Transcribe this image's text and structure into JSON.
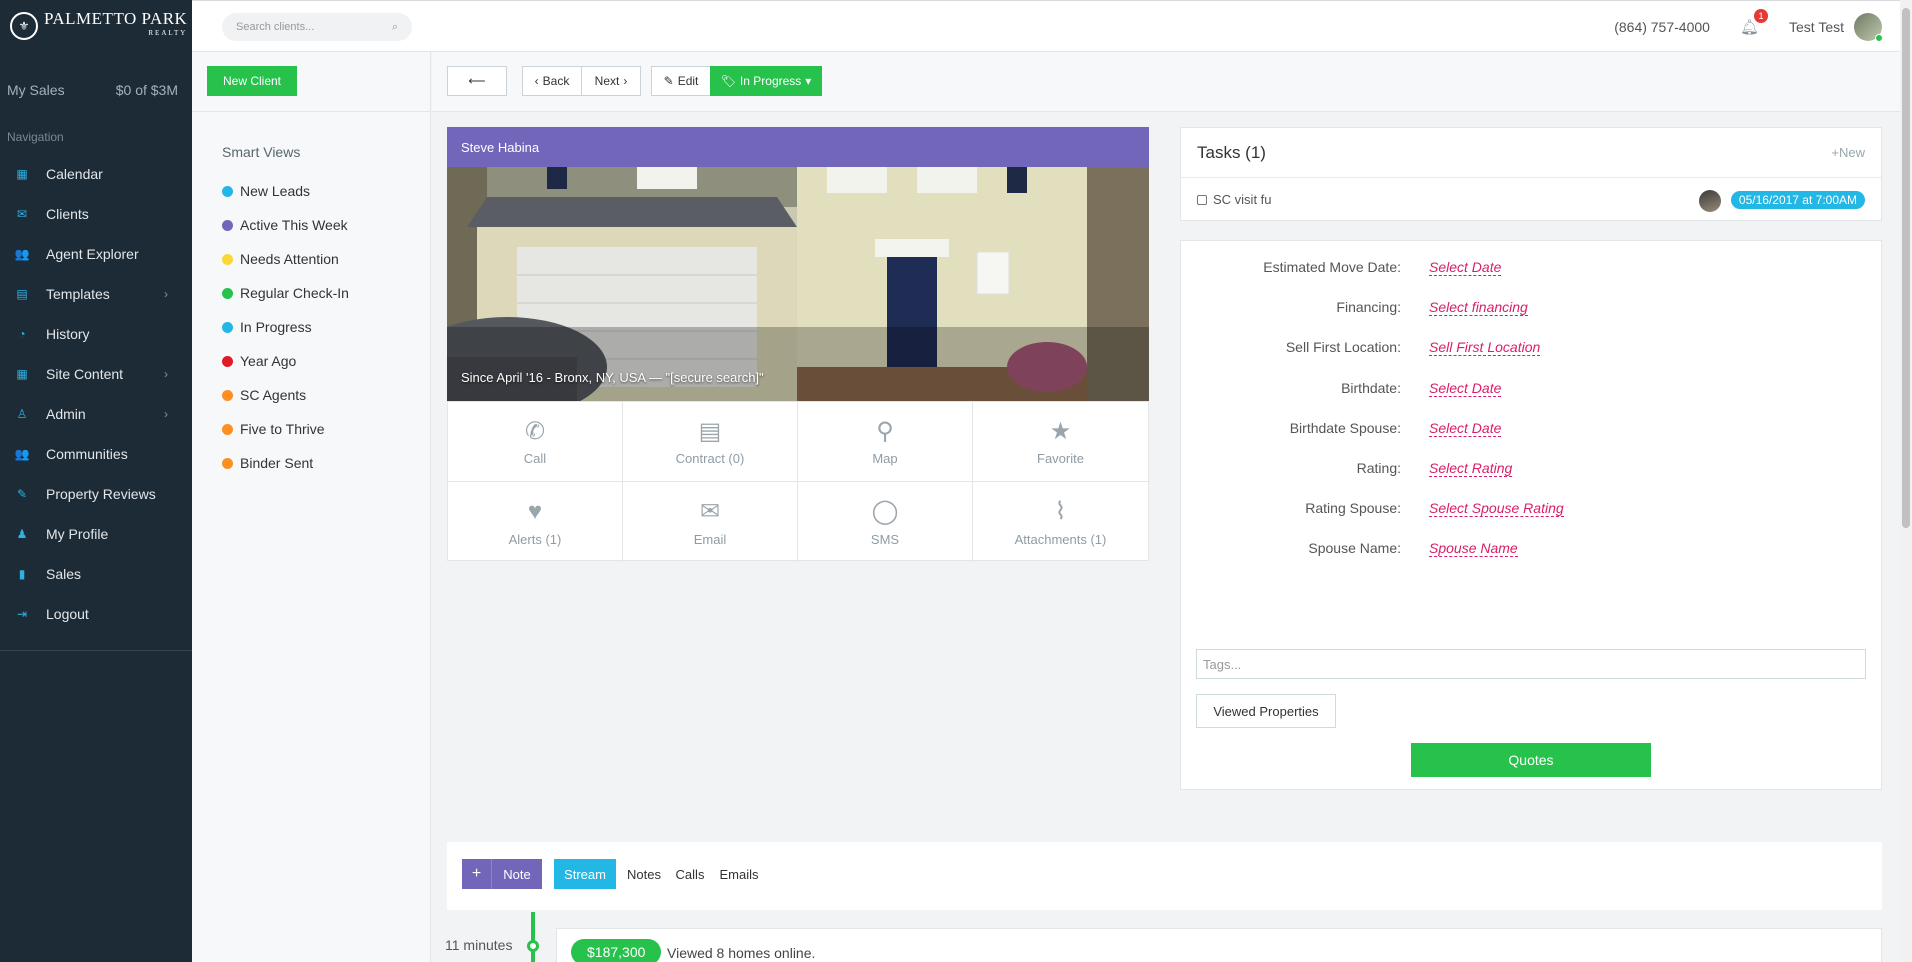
{
  "brand": {
    "name": "PALMETTO PARK",
    "sub": "REALTY"
  },
  "sidebar": {
    "my_sales_label": "My Sales",
    "my_sales_value": "$0 of $3M",
    "nav_heading": "Navigation",
    "items": [
      {
        "label": "Calendar",
        "icon": "calendar-icon",
        "glyph": "▦"
      },
      {
        "label": "Clients",
        "icon": "envelope-icon",
        "glyph": "✉"
      },
      {
        "label": "Agent Explorer",
        "icon": "users-icon",
        "glyph": "👥"
      },
      {
        "label": "Templates",
        "icon": "file-icon",
        "glyph": "▤"
      },
      {
        "label": "History",
        "icon": "rss-icon",
        "glyph": "◔"
      },
      {
        "label": "Site Content",
        "icon": "grid-icon",
        "glyph": "▦"
      },
      {
        "label": "Admin",
        "icon": "user-icon",
        "glyph": "♙"
      },
      {
        "label": "Communities",
        "icon": "users-icon",
        "glyph": "👥"
      },
      {
        "label": "Property Reviews",
        "icon": "edit-icon",
        "glyph": "✎"
      },
      {
        "label": "My Profile",
        "icon": "user-icon",
        "glyph": "♟"
      },
      {
        "label": "Sales",
        "icon": "bar-chart-icon",
        "glyph": "▮"
      },
      {
        "label": "Logout",
        "icon": "logout-icon",
        "glyph": "⇥"
      }
    ]
  },
  "topbar": {
    "search_placeholder": "Search clients...",
    "phone": "(864) 757-4000",
    "notifications": "1",
    "user_name": "Test Test"
  },
  "smart_views": {
    "new_client": "New Client",
    "heading": "Smart Views",
    "items": [
      {
        "label": "New Leads",
        "color": "#23b7e5"
      },
      {
        "label": "Active This Week",
        "color": "#7266ba"
      },
      {
        "label": "Needs Attention",
        "color": "#fad733"
      },
      {
        "label": "Regular Check-In",
        "color": "#27c24c"
      },
      {
        "label": "In Progress",
        "color": "#23b7e5"
      },
      {
        "label": "Year Ago",
        "color": "#e01b24"
      },
      {
        "label": "SC Agents",
        "color": "#ff8f1f"
      },
      {
        "label": "Five to Thrive",
        "color": "#ff8f1f"
      },
      {
        "label": "Binder Sent",
        "color": "#ff8f1f"
      }
    ]
  },
  "toolbar": {
    "back_arrow": "⟵",
    "back": "Back",
    "next": "Next",
    "edit": "Edit",
    "status": "In Progress"
  },
  "client": {
    "name": "Steve Habina",
    "caption": "Since April '16 - Bronx, NY, USA — \"[secure search]\"",
    "actions": [
      {
        "label": "Call",
        "icon": "phone-icon",
        "glyph": "✆"
      },
      {
        "label": "Contract (0)",
        "icon": "document-icon",
        "glyph": "▤"
      },
      {
        "label": "Map",
        "icon": "map-pin-icon",
        "glyph": "⚲"
      },
      {
        "label": "Favorite",
        "icon": "star-icon",
        "glyph": "★"
      },
      {
        "label": "Alerts (1)",
        "icon": "heart-icon",
        "glyph": "♥"
      },
      {
        "label": "Email",
        "icon": "envelope-icon",
        "glyph": "✉"
      },
      {
        "label": "SMS",
        "icon": "chat-bubble-icon",
        "glyph": "◯"
      },
      {
        "label": "Attachments (1)",
        "icon": "paperclip-icon",
        "glyph": "⌇"
      }
    ]
  },
  "tasks": {
    "title": "Tasks (1)",
    "new_label": "+New",
    "items": [
      {
        "label": "SC visit fu",
        "date": "05/16/2017 at 7:00AM"
      }
    ]
  },
  "details": {
    "fields": [
      {
        "label": "Estimated Move Date:",
        "value": "Select Date"
      },
      {
        "label": "Financing:",
        "value": "Select financing"
      },
      {
        "label": "Sell First Location:",
        "value": "Sell First Location"
      },
      {
        "label": "Birthdate:",
        "value": "Select Date"
      },
      {
        "label": "Birthdate Spouse:",
        "value": "Select Date"
      },
      {
        "label": "Rating:",
        "value": "Select Rating"
      },
      {
        "label": "Rating Spouse:",
        "value": "Select Spouse Rating"
      },
      {
        "label": "Spouse Name:",
        "value": "Spouse Name"
      }
    ],
    "tags_placeholder": "Tags...",
    "viewed_properties": "Viewed Properties",
    "quotes": "Quotes"
  },
  "stream": {
    "note_plus": "+",
    "note": "Note",
    "tabs": [
      "Stream",
      "Notes",
      "Calls",
      "Emails"
    ],
    "active_tab": "Stream"
  },
  "timeline": {
    "time": "11 minutes",
    "price": "$187,300",
    "text": "Viewed 8 homes online."
  }
}
